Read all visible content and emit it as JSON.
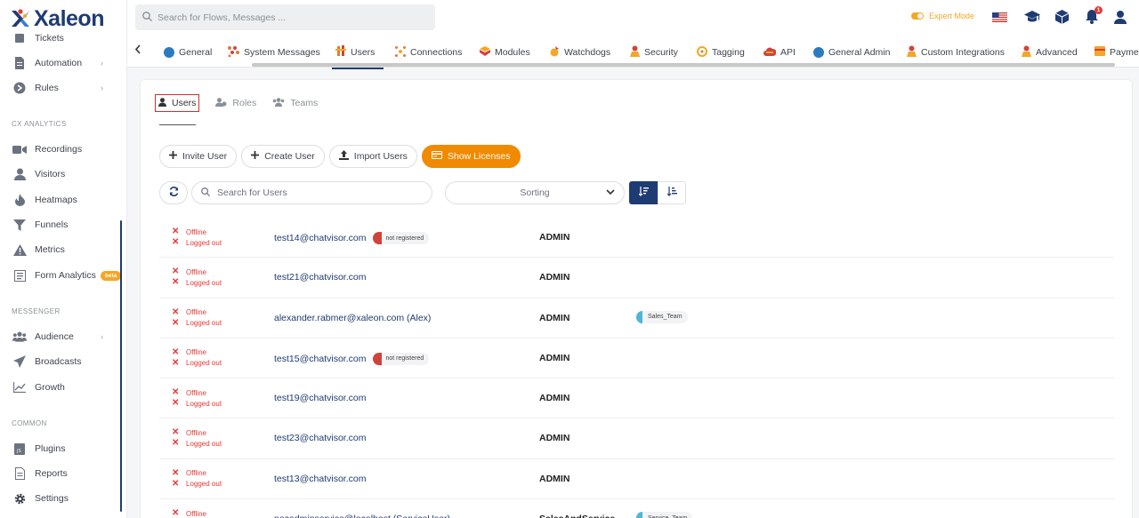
{
  "brand": {
    "name": "Xaleon"
  },
  "search": {
    "placeholder": "Search for Flows, Messages ..."
  },
  "topbar": {
    "expert_mode": "Expert Mode",
    "notification_count": "1"
  },
  "sidebar": {
    "items": [
      {
        "label": "Tickets",
        "icon": "ticket-icon"
      },
      {
        "label": "Automation",
        "icon": "automation-icon",
        "chevron": "›"
      },
      {
        "label": "Rules",
        "icon": "rules-icon",
        "chevron": "›"
      }
    ],
    "section_cx": "CX ANALYTICS",
    "cx_items": [
      {
        "label": "Recordings",
        "icon": "video-icon"
      },
      {
        "label": "Visitors",
        "icon": "user-icon"
      },
      {
        "label": "Heatmaps",
        "icon": "flame-icon"
      },
      {
        "label": "Funnels",
        "icon": "funnel-icon"
      },
      {
        "label": "Metrics",
        "icon": "warning-icon"
      },
      {
        "label": "Form Analytics",
        "icon": "form-icon",
        "badge": "beta"
      }
    ],
    "section_messenger": "MESSENGER",
    "messenger_items": [
      {
        "label": "Audience",
        "icon": "users-icon",
        "chevron": "›"
      },
      {
        "label": "Broadcasts",
        "icon": "send-icon"
      },
      {
        "label": "Growth",
        "icon": "chart-icon"
      }
    ],
    "section_common": "COMMON",
    "common_items": [
      {
        "label": "Plugins",
        "icon": "plugin-icon"
      },
      {
        "label": "Reports",
        "icon": "report-icon"
      },
      {
        "label": "Settings",
        "icon": "gear-icon"
      }
    ]
  },
  "tabs": [
    {
      "label": "General"
    },
    {
      "label": "System Messages"
    },
    {
      "label": "Users"
    },
    {
      "label": "Connections"
    },
    {
      "label": "Modules"
    },
    {
      "label": "Watchdogs"
    },
    {
      "label": "Security"
    },
    {
      "label": "Tagging"
    },
    {
      "label": "API"
    },
    {
      "label": "General Admin"
    },
    {
      "label": "Custom Integrations"
    },
    {
      "label": "Advanced"
    },
    {
      "label": "Payme"
    }
  ],
  "subtabs": {
    "users": "Users",
    "roles": "Roles",
    "teams": "Teams"
  },
  "actions": {
    "invite": "Invite User",
    "create": "Create User",
    "import": "Import Users",
    "licenses": "Show Licenses"
  },
  "filters": {
    "search_placeholder": "Search for Users",
    "sorting": "Sorting"
  },
  "users": [
    {
      "status": "Offline",
      "session": "Logged out",
      "email": "test14@chatvisor.com",
      "badge": "not registered",
      "role": "ADMIN",
      "team": ""
    },
    {
      "status": "Offline",
      "session": "Logged out",
      "email": "test21@chatvisor.com",
      "badge": "",
      "role": "ADMIN",
      "team": ""
    },
    {
      "status": "Offline",
      "session": "Logged out",
      "email": "alexander.rabmer@xaleon.com (Alex)",
      "badge": "",
      "role": "ADMIN",
      "team": "Sales_Team"
    },
    {
      "status": "Offline",
      "session": "Logged out",
      "email": "test15@chatvisor.com",
      "badge": "not registered",
      "role": "ADMIN",
      "team": ""
    },
    {
      "status": "Offline",
      "session": "Logged out",
      "email": "test19@chatvisor.com",
      "badge": "",
      "role": "ADMIN",
      "team": ""
    },
    {
      "status": "Offline",
      "session": "Logged out",
      "email": "test23@chatvisor.com",
      "badge": "",
      "role": "ADMIN",
      "team": ""
    },
    {
      "status": "Offline",
      "session": "Logged out",
      "email": "test13@chatvisor.com",
      "badge": "",
      "role": "ADMIN",
      "team": ""
    },
    {
      "status": "Offline",
      "session": "",
      "email": "nocadminservice@localhost (ServiceUser)",
      "badge": "",
      "role": "SalesAndService",
      "team": "Service_Team"
    }
  ],
  "colors": {
    "brand": "#1f3b73",
    "accent": "#f08a00",
    "offline": "#e53935"
  }
}
